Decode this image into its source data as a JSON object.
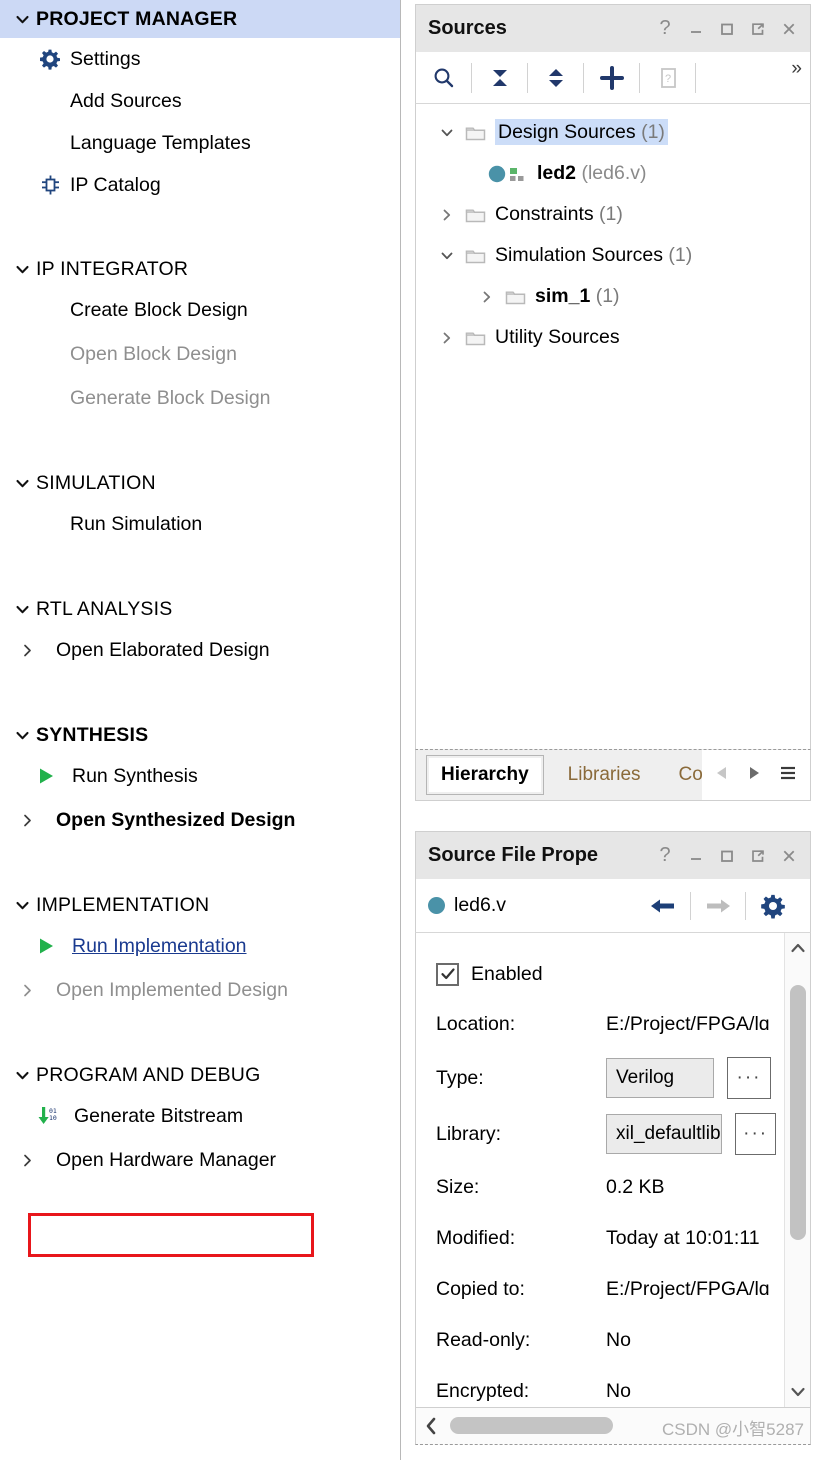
{
  "flow_navigator": {
    "sections": [
      {
        "id": "project-manager",
        "title": "PROJECT MANAGER",
        "highlighted": true,
        "items": [
          {
            "label": "Settings",
            "icon": "gear-icon",
            "state": "normal"
          },
          {
            "label": "Add Sources",
            "icon": "none",
            "state": "normal"
          },
          {
            "label": "Language Templates",
            "icon": "none",
            "state": "normal"
          },
          {
            "label": "IP Catalog",
            "icon": "ip-core-icon",
            "state": "normal"
          }
        ]
      },
      {
        "id": "ip-integrator",
        "title": "IP INTEGRATOR",
        "highlighted": false,
        "items": [
          {
            "label": "Create Block Design",
            "icon": "none",
            "state": "normal"
          },
          {
            "label": "Open Block Design",
            "icon": "none",
            "state": "disabled"
          },
          {
            "label": "Generate Block Design",
            "icon": "none",
            "state": "disabled"
          }
        ]
      },
      {
        "id": "simulation",
        "title": "SIMULATION",
        "highlighted": false,
        "items": [
          {
            "label": "Run Simulation",
            "icon": "none",
            "state": "normal"
          }
        ]
      },
      {
        "id": "rtl-analysis",
        "title": "RTL ANALYSIS",
        "highlighted": false,
        "items": [
          {
            "label": "Open Elaborated Design",
            "icon": "expand-arrow",
            "state": "normal"
          }
        ]
      },
      {
        "id": "synthesis",
        "title": "SYNTHESIS",
        "highlighted": false,
        "bold_title": true,
        "items": [
          {
            "label": "Run Synthesis",
            "icon": "green-play-icon",
            "state": "normal"
          },
          {
            "label": "Open Synthesized Design",
            "icon": "expand-arrow",
            "state": "bold"
          }
        ]
      },
      {
        "id": "implementation",
        "title": "IMPLEMENTATION",
        "highlighted": false,
        "items": [
          {
            "label": "Run Implementation",
            "icon": "green-play-icon",
            "state": "link"
          },
          {
            "label": "Open Implemented Design",
            "icon": "expand-arrow",
            "state": "disabled"
          }
        ]
      },
      {
        "id": "program-and-debug",
        "title": "PROGRAM AND DEBUG",
        "highlighted": false,
        "items": [
          {
            "label": "Generate Bitstream",
            "icon": "generate-bitstream-icon",
            "state": "normal",
            "callout": true
          },
          {
            "label": "Open Hardware Manager",
            "icon": "expand-arrow",
            "state": "normal"
          }
        ]
      }
    ]
  },
  "sources_panel": {
    "title": "Sources",
    "window_buttons": [
      "help-icon",
      "minimize-icon",
      "maximize-icon",
      "float-icon",
      "close-icon"
    ],
    "toolbar": [
      {
        "name": "search-icon"
      },
      {
        "name": "collapse-all-icon"
      },
      {
        "name": "expand-all-icon"
      },
      {
        "name": "add-sources-icon"
      },
      {
        "name": "report-icon"
      }
    ],
    "toolbar_overflow": "»",
    "tree": [
      {
        "indent": 0,
        "caret": "down",
        "icon": "folder-icon",
        "label": "Design Sources",
        "count": "(1)",
        "selected": true
      },
      {
        "indent": 1,
        "caret": "none",
        "icon": "verilog-module-icon",
        "label": "led2",
        "file": "(led6.v)",
        "bold": true
      },
      {
        "indent": 0,
        "caret": "right",
        "icon": "folder-icon",
        "label": "Constraints",
        "count": "(1)",
        "selected": false
      },
      {
        "indent": 0,
        "caret": "down",
        "icon": "folder-icon",
        "label": "Simulation Sources",
        "count": "(1)",
        "selected": false
      },
      {
        "indent": 1,
        "caret": "right",
        "icon": "folder-icon",
        "label": "sim_1",
        "count": "(1)",
        "selected": false
      },
      {
        "indent": 0,
        "caret": "right",
        "icon": "folder-icon",
        "label": "Utility Sources",
        "count": "",
        "selected": false
      }
    ],
    "tabs": [
      {
        "label": "Hierarchy",
        "active": true
      },
      {
        "label": "Libraries",
        "active": false
      },
      {
        "label": "Co",
        "active": false
      }
    ],
    "tab_nav": [
      "prev-tab-icon",
      "next-tab-icon",
      "tab-menu-icon"
    ]
  },
  "source_file_properties": {
    "title": "Source File Prope",
    "window_buttons": [
      "help-icon",
      "minimize-icon",
      "maximize-icon",
      "float-icon",
      "close-icon"
    ],
    "file_name": "led6.v",
    "actions": [
      "back-icon",
      "forward-icon",
      "settings-gear-icon"
    ],
    "enabled_label": "Enabled",
    "enabled_checked": true,
    "rows": [
      {
        "key": "Location:",
        "value": "E:/Project/FPGA/lɑ",
        "type": "text"
      },
      {
        "key": "Type:",
        "value": "Verilog",
        "type": "field"
      },
      {
        "key": "Library:",
        "value": "xil_defaultlib",
        "type": "field"
      },
      {
        "key": "Size:",
        "value": "0.2 KB",
        "type": "text"
      },
      {
        "key": "Modified:",
        "value": "Today at 10:01:11",
        "type": "text"
      },
      {
        "key": "Copied to:",
        "value": "E:/Project/FPGA/lɑ",
        "type": "text"
      },
      {
        "key": "Read-only:",
        "value": "No",
        "type": "text"
      },
      {
        "key": "Encrypted:",
        "value": "No",
        "type": "text"
      }
    ],
    "dots_button_label": "···"
  },
  "watermark": "CSDN @小智5287",
  "colors": {
    "section_highlight": "#ccd9f5",
    "tree_selection": "#ccddf8",
    "callout_red": "#e8161b",
    "green_play": "#22b14c",
    "link_blue": "#1a3a8f",
    "accent_navy": "#21386b",
    "module_dot_teal": "#4a92a8"
  }
}
